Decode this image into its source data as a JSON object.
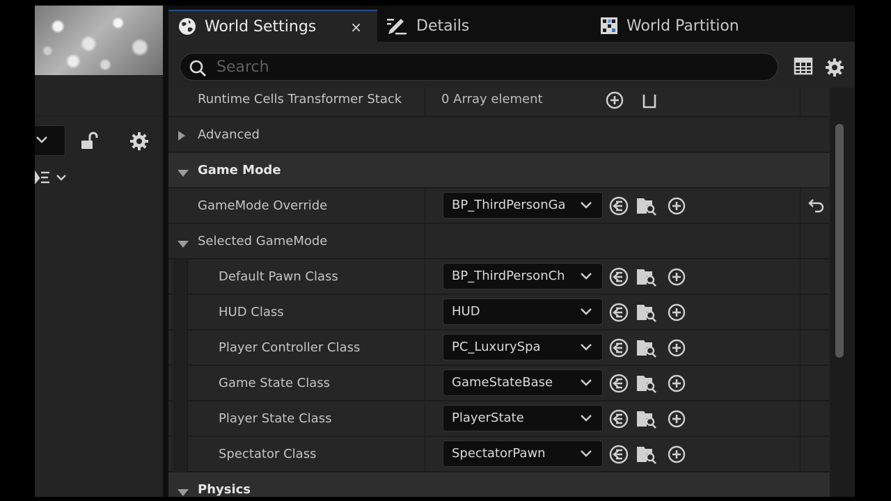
{
  "tabs": [
    {
      "label": "World Settings",
      "icon": "globe-icon",
      "active": true,
      "close": "×"
    },
    {
      "label": "Details",
      "icon": "pencil-icon",
      "active": false
    },
    {
      "label": "World Partition",
      "icon": "grid-map-icon",
      "active": false
    }
  ],
  "search": {
    "placeholder": "Search"
  },
  "rows": {
    "runtime": {
      "label": "Runtime Cells Transformer Stack",
      "value": "0 Array element"
    },
    "advanced": {
      "label": "Advanced"
    },
    "game_mode": {
      "label": "Game Mode"
    },
    "gamemode_override": {
      "label": "GameMode Override",
      "value": "BP_ThirdPersonGa"
    },
    "selected_gamemode": {
      "label": "Selected GameMode"
    },
    "default_pawn": {
      "label": "Default Pawn Class",
      "value": "BP_ThirdPersonCh"
    },
    "hud": {
      "label": "HUD Class",
      "value": "HUD"
    },
    "player_controller": {
      "label": "Player Controller Class",
      "value": "PC_LuxurySpa"
    },
    "game_state": {
      "label": "Game State Class",
      "value": "GameStateBase"
    },
    "player_state": {
      "label": "Player State Class",
      "value": "PlayerState"
    },
    "spectator": {
      "label": "Spectator Class",
      "value": "SpectatorPawn"
    },
    "physics": {
      "label": "Physics"
    }
  },
  "colors": {
    "accent": "#2a4d84",
    "panel": "#262626",
    "category": "#2e2e2e",
    "background": "#151515"
  }
}
